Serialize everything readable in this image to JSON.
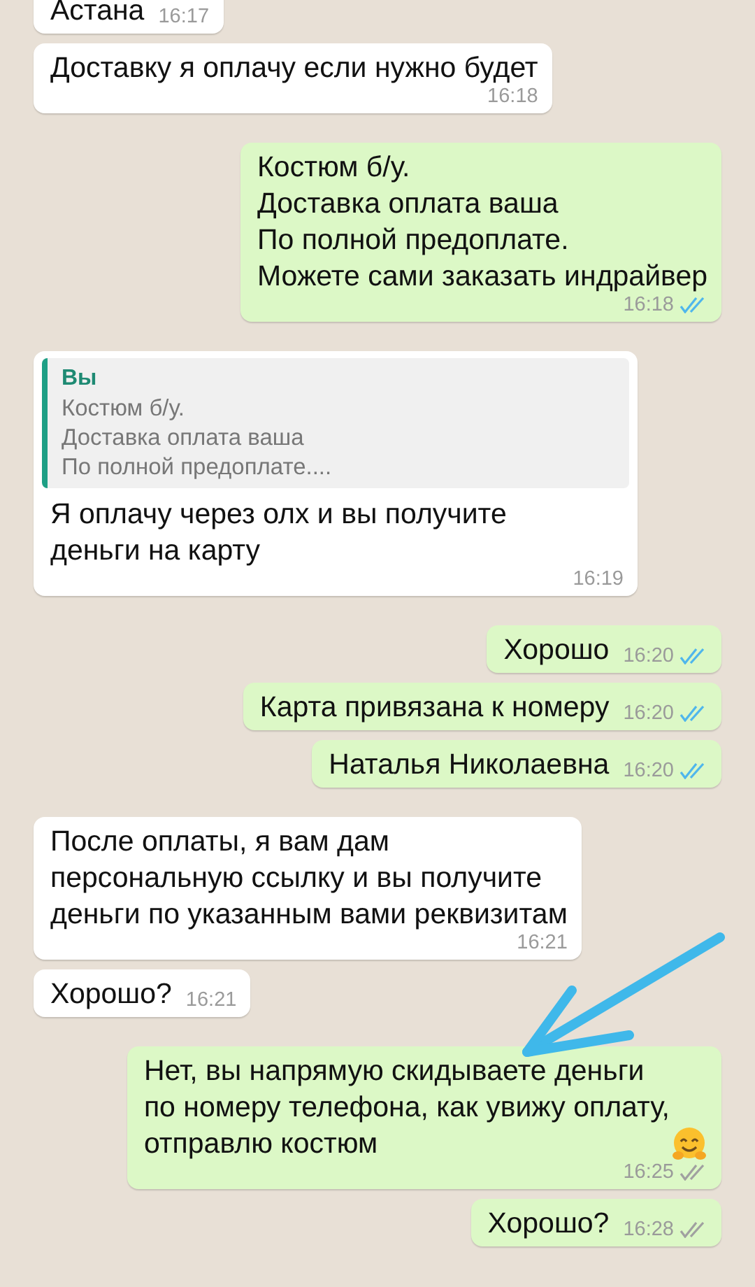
{
  "messages": [
    {
      "kind": "incoming",
      "text": "Астана",
      "time": "16:17"
    },
    {
      "kind": "incoming",
      "text": "Доставку я оплачу если нужно будет",
      "time": "16:18"
    },
    {
      "kind": "outgoing",
      "text": "Костюм б/у.\nДоставка оплата ваша\nПо полной предоплате.\nМожете сами заказать индрайвер",
      "time": "16:18",
      "read": true
    },
    {
      "kind": "incoming",
      "quote": {
        "sender": "Вы",
        "text": "Костюм б/у.\nДоставка оплата ваша\nПо полной предоплате...."
      },
      "text": "Я оплачу через олх и вы получите\nденьги на карту",
      "time": "16:19"
    },
    {
      "kind": "outgoing",
      "text": "Хорошо",
      "time": "16:20",
      "read": true
    },
    {
      "kind": "outgoing",
      "text": "Карта привязана к номеру",
      "time": "16:20",
      "read": true
    },
    {
      "kind": "outgoing",
      "text": "Наталья Николаевна",
      "time": "16:20",
      "read": true
    },
    {
      "kind": "incoming",
      "text": "После оплаты, я вам дам\nперсональную ссылку и вы получите\nденьги по указанным вами реквизитам",
      "time": "16:21"
    },
    {
      "kind": "incoming",
      "text": "Хорошо?",
      "time": "16:21"
    },
    {
      "kind": "outgoing",
      "text": "Нет, вы напрямую скидываете деньги\nпо номеру телефона, как увижу оплату,\nотправлю костюм",
      "emoji": true,
      "time": "16:25",
      "read": false
    },
    {
      "kind": "outgoing",
      "text": "Хорошо?",
      "time": "16:28",
      "read": false
    }
  ],
  "annotation_arrow": true
}
